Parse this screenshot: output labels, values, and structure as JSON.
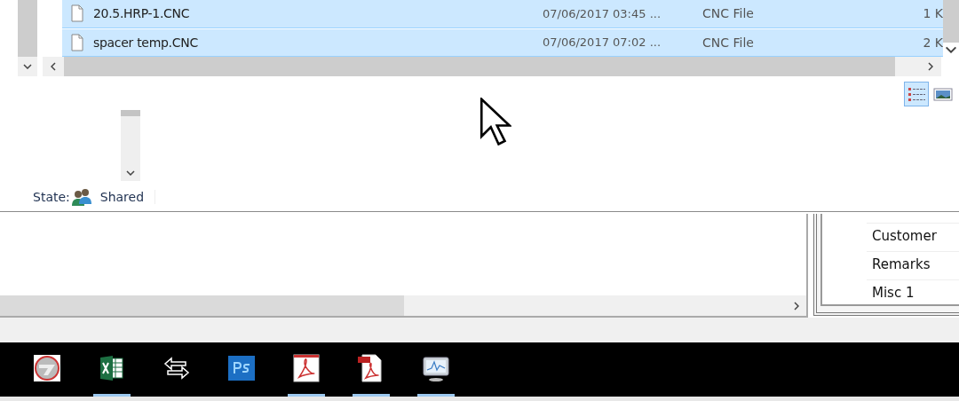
{
  "files": [
    {
      "name": "20.5.HRP-1.CNC",
      "date": "07/06/2017 03:45 ...",
      "type": "CNC File",
      "size": "1 K",
      "selected": true
    },
    {
      "name": "spacer temp.CNC",
      "date": "07/06/2017 07:02 ...",
      "type": "CNC File",
      "size": "2 K",
      "selected": true
    }
  ],
  "view_buttons": [
    {
      "kind": "details",
      "selected": true
    },
    {
      "kind": "preview",
      "selected": false
    }
  ],
  "status_bar": {
    "label": "State:",
    "value": "Shared"
  },
  "properties": [
    "Customer",
    "Remarks",
    "Misc 1"
  ],
  "taskbar": [
    {
      "kind": "disc",
      "running": false
    },
    {
      "kind": "excel",
      "running": true
    },
    {
      "kind": "arrows",
      "running": false
    },
    {
      "kind": "ps",
      "running": false
    },
    {
      "kind": "pdf",
      "running": true
    },
    {
      "kind": "pdfdoc",
      "running": true
    },
    {
      "kind": "monitor",
      "running": true
    }
  ]
}
